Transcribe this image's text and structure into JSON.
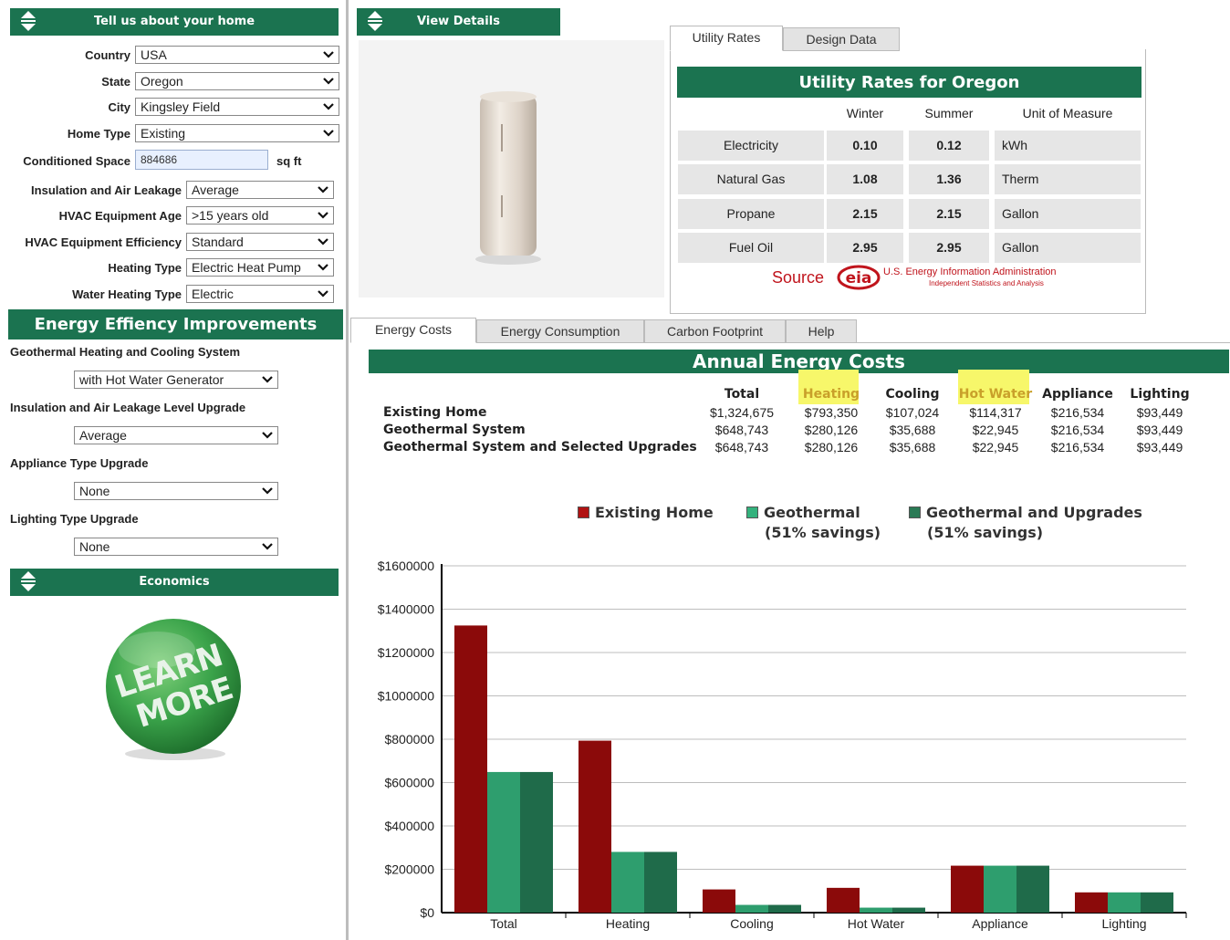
{
  "left_panel": {
    "header_title": "Tell us about your home",
    "fields": [
      {
        "label": "Country",
        "value": "USA"
      },
      {
        "label": "State",
        "value": "Oregon"
      },
      {
        "label": "City",
        "value": "Kingsley Field"
      },
      {
        "label": "Home Type",
        "value": "Existing"
      }
    ],
    "conditioned_space": {
      "label": "Conditioned Space",
      "value": "884686",
      "unit": "sq ft"
    },
    "fields2": [
      {
        "label": "Insulation and Air Leakage",
        "value": "Average"
      },
      {
        "label": "HVAC Equipment Age",
        "value": ">15 years old"
      },
      {
        "label": "HVAC Equipment Efficiency",
        "value": "Standard"
      },
      {
        "label": "Heating Type",
        "value": "Electric Heat Pump"
      },
      {
        "label": "Water Heating Type",
        "value": "Electric"
      }
    ],
    "improvements_title": "Energy Effiency Improvements",
    "improvements": [
      {
        "label": "Geothermal Heating and Cooling System",
        "value": "with Hot Water Generator"
      },
      {
        "label": "Insulation and Air Leakage Level Upgrade",
        "value": "Average"
      },
      {
        "label": "Appliance Type Upgrade",
        "value": "None"
      },
      {
        "label": "Lighting Type Upgrade",
        "value": "None"
      }
    ],
    "economics_title": "Economics",
    "learn_more": {
      "line1": "LEARN",
      "line2": "MORE"
    }
  },
  "view_details": {
    "header_title": "View Details"
  },
  "rates_panel": {
    "tabs": [
      "Utility Rates",
      "Design Data"
    ],
    "title": "Utility Rates for Oregon",
    "columns": [
      "Winter",
      "Summer",
      "Unit of Measure"
    ],
    "rows": [
      {
        "name": "Electricity",
        "winter": "0.10",
        "summer": "0.12",
        "unit": "kWh"
      },
      {
        "name": "Natural Gas",
        "winter": "1.08",
        "summer": "1.36",
        "unit": "Therm"
      },
      {
        "name": "Propane",
        "winter": "2.15",
        "summer": "2.15",
        "unit": "Gallon"
      },
      {
        "name": "Fuel Oil",
        "winter": "2.95",
        "summer": "2.95",
        "unit": "Gallon"
      }
    ],
    "source_label": "Source",
    "eia_logo": "eia",
    "eia_line1": "U.S. Energy Information Administration",
    "eia_line2": "Independent Statistics and Analysis"
  },
  "costs_panel": {
    "tabs": [
      "Energy Costs",
      "Energy Consumption",
      "Carbon Footprint",
      "Help"
    ],
    "title": "Annual Energy Costs",
    "columns": [
      "Total",
      "Heating",
      "Cooling",
      "Hot Water",
      "Appliance",
      "Lighting"
    ],
    "rows": [
      {
        "label": "Existing Home",
        "values": [
          "$1,324,675",
          "$793,350",
          "$107,024",
          "$114,317",
          "$216,534",
          "$93,449"
        ]
      },
      {
        "label": "Geothermal System",
        "values": [
          "$648,743",
          "$280,126",
          "$35,688",
          "$22,945",
          "$216,534",
          "$93,449"
        ]
      },
      {
        "label": "Geothermal System and Selected Upgrades",
        "values": [
          "$648,743",
          "$280,126",
          "$35,688",
          "$22,945",
          "$216,534",
          "$93,449"
        ]
      }
    ],
    "highlight_color": "#f7f76a"
  },
  "chart_data": {
    "type": "bar",
    "categories": [
      "Total",
      "Heating",
      "Cooling",
      "Hot Water",
      "Appliance",
      "Lighting"
    ],
    "series": [
      {
        "name": "Existing Home",
        "values": [
          1324675,
          793350,
          107024,
          114317,
          216534,
          93449
        ],
        "color": "#8b0a0a"
      },
      {
        "name": "Geothermal",
        "note": "(51% savings)",
        "values": [
          648743,
          280126,
          35688,
          22945,
          216534,
          93449
        ],
        "color": "#2e9e6e"
      },
      {
        "name": "Geothermal and Upgrades",
        "note": "(51% savings)",
        "values": [
          648743,
          280126,
          35688,
          22945,
          216534,
          93449
        ],
        "color": "#1f6b4a"
      }
    ],
    "yticks": [
      "$0",
      "$200000",
      "$400000",
      "$600000",
      "$800000",
      "$1000000",
      "$1200000",
      "$1400000",
      "$1600000"
    ],
    "ylim": [
      0,
      1600000
    ],
    "grid": true,
    "legend": "top"
  },
  "colors": {
    "brand_green": "#1b7350",
    "source_red": "#c0141c"
  }
}
